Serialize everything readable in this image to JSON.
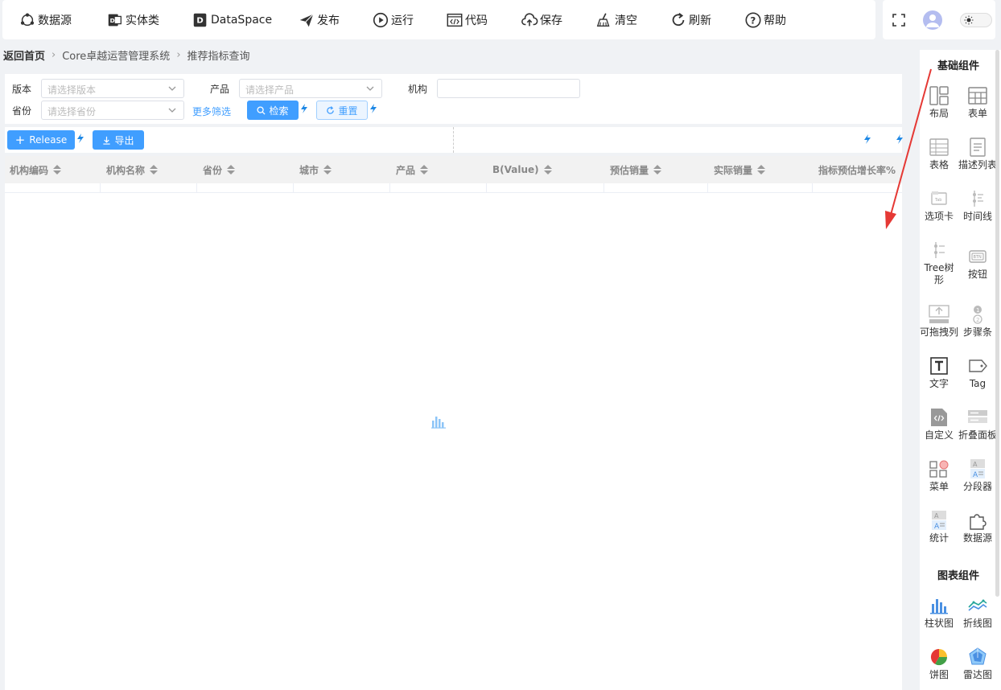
{
  "toolbar": {
    "items": [
      {
        "label": "数据源",
        "icon": "datasource-icon"
      },
      {
        "label": "实体类",
        "icon": "entity-icon"
      },
      {
        "label": "DataSpace",
        "icon": "dataspace-icon"
      },
      {
        "label": "发布",
        "icon": "send-icon"
      },
      {
        "label": "运行",
        "icon": "play-icon"
      },
      {
        "label": "代码",
        "icon": "code-icon"
      },
      {
        "label": "保存",
        "icon": "cloud-upload-icon"
      },
      {
        "label": "清空",
        "icon": "broom-icon"
      },
      {
        "label": "刷新",
        "icon": "refresh-icon"
      },
      {
        "label": "帮助",
        "icon": "help-icon"
      }
    ]
  },
  "breadcrumb": {
    "home": "返回首页",
    "level1": "Core卓越运营管理系统",
    "level2": "推荐指标查询"
  },
  "filters": {
    "version_label": "版本",
    "version_placeholder": "请选择版本",
    "product_label": "产品",
    "product_placeholder": "请选择产品",
    "org_label": "机构",
    "province_label": "省份",
    "province_placeholder": "请选择省份",
    "more": "更多筛选",
    "search": "检索",
    "reset": "重置"
  },
  "actions": {
    "release": "Release",
    "export": "导出"
  },
  "table": {
    "columns": [
      "机构编码",
      "机构名称",
      "省份",
      "城市",
      "产品",
      "B(Value)",
      "预估销量",
      "实际销量",
      "指标预估增长率%"
    ]
  },
  "panel": {
    "basic_title": "基础组件",
    "basic": [
      {
        "label": "布局",
        "icon": "layout-icon"
      },
      {
        "label": "表单",
        "icon": "form-icon"
      },
      {
        "label": "表格",
        "icon": "table-icon"
      },
      {
        "label": "描述列表",
        "icon": "description-list-icon"
      },
      {
        "label": "选项卡",
        "icon": "tabs-icon"
      },
      {
        "label": "时间线",
        "icon": "timeline-icon"
      },
      {
        "label": "Tree树形",
        "icon": "tree-icon"
      },
      {
        "label": "按钮",
        "icon": "button-icon"
      },
      {
        "label": "可拖拽列",
        "icon": "draggable-icon"
      },
      {
        "label": "步骤条",
        "icon": "steps-icon"
      },
      {
        "label": "文字",
        "icon": "text-icon"
      },
      {
        "label": "Tag",
        "icon": "tag-icon"
      },
      {
        "label": "自定义",
        "icon": "custom-code-icon"
      },
      {
        "label": "折叠面板",
        "icon": "collapse-icon"
      },
      {
        "label": "菜单",
        "icon": "menu-icon"
      },
      {
        "label": "分段器",
        "icon": "segmented-icon"
      },
      {
        "label": "统计",
        "icon": "statistic-icon"
      },
      {
        "label": "数据源",
        "icon": "puzzle-icon"
      }
    ],
    "chart_title": "图表组件",
    "charts": [
      {
        "label": "柱状图",
        "icon": "bar-chart-icon"
      },
      {
        "label": "折线图",
        "icon": "line-chart-icon"
      },
      {
        "label": "饼图",
        "icon": "pie-chart-icon"
      },
      {
        "label": "雷达图",
        "icon": "radar-chart-icon"
      }
    ]
  },
  "colors": {
    "primary": "#409eff",
    "arrow": "#e53935"
  }
}
